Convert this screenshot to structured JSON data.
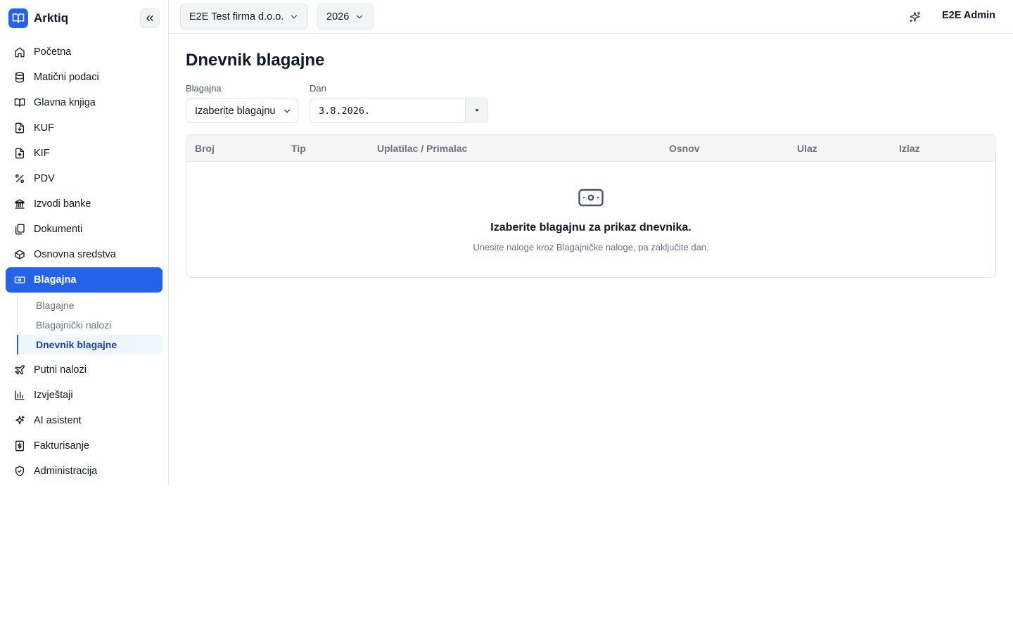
{
  "app": {
    "name": "Arktiq"
  },
  "topbar": {
    "company": "E2E Test firma d.o.o.",
    "year": "2026",
    "user": "E2E Admin"
  },
  "sidebar": {
    "items": [
      {
        "label": "Početna",
        "icon": "home-icon"
      },
      {
        "label": "Matični podaci",
        "icon": "database-icon"
      },
      {
        "label": "Glavna knjiga",
        "icon": "book-open-icon"
      },
      {
        "label": "KUF",
        "icon": "file-download-icon"
      },
      {
        "label": "KIF",
        "icon": "file-upload-icon"
      },
      {
        "label": "PDV",
        "icon": "percent-icon"
      },
      {
        "label": "Izvodi banke",
        "icon": "bank-icon"
      },
      {
        "label": "Dokumenti",
        "icon": "files-icon"
      },
      {
        "label": "Osnovna sredstva",
        "icon": "box-icon"
      },
      {
        "label": "Blagajna",
        "icon": "banknote-icon"
      },
      {
        "label": "Putni nalozi",
        "icon": "plane-icon"
      },
      {
        "label": "Izvještaji",
        "icon": "bar-chart-icon"
      },
      {
        "label": "AI asistent",
        "icon": "sparkles-icon"
      },
      {
        "label": "Fakturisanje",
        "icon": "receipt-dollar-icon"
      },
      {
        "label": "Administracija",
        "icon": "shield-check-icon"
      }
    ],
    "sub_items": [
      {
        "label": "Blagajne"
      },
      {
        "label": "Blagajnički nalozi"
      },
      {
        "label": "Dnevnik blagajne"
      }
    ],
    "active_item": "Blagajna",
    "active_sub_item": "Dnevnik blagajne"
  },
  "page": {
    "title": "Dnevnik blagajne",
    "filters": {
      "cashbox_label": "Blagajna",
      "cashbox_value": "Izaberite blagajnu",
      "day_label": "Dan",
      "day_value": "3.8.2026."
    },
    "table": {
      "columns": [
        "Broj",
        "Tip",
        "Uplatilac / Primalac",
        "Osnov",
        "Ulaz",
        "Izlaz"
      ],
      "rows": []
    },
    "empty_state": {
      "icon": "banknote-icon",
      "title": "Izaberite blagajnu za prikaz dnevnika.",
      "subtitle": "Unesite naloge kroz Blagajničke naloge, pa zaključite dan."
    }
  },
  "colors": {
    "accent": "#2563eb",
    "active_sub_bg": "#eff6ff",
    "active_sub_text": "#1e40af",
    "border": "#e5e7eb"
  }
}
